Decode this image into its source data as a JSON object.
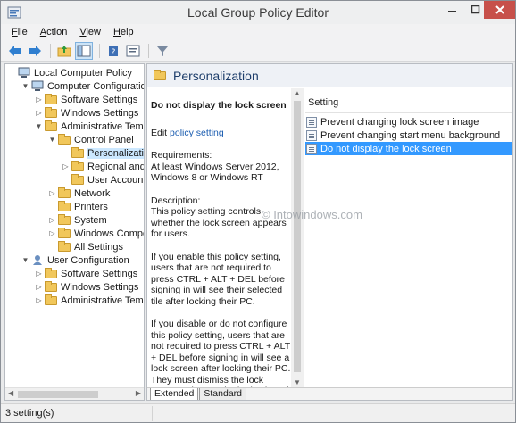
{
  "window": {
    "title": "Local Group Policy Editor"
  },
  "menubar": {
    "items": [
      {
        "pre": "",
        "key": "F",
        "post": "ile"
      },
      {
        "pre": "",
        "key": "A",
        "post": "ction"
      },
      {
        "pre": "",
        "key": "V",
        "post": "iew"
      },
      {
        "pre": "",
        "key": "H",
        "post": "elp"
      }
    ]
  },
  "toolbar": {
    "buttons": [
      "back-arrow-icon",
      "forward-arrow-icon",
      "up-folder-icon",
      "show-hide-tree-icon",
      "help-book-icon",
      "properties-icon",
      "filter-icon"
    ]
  },
  "tree": {
    "items": [
      {
        "label": "Local Computer Policy",
        "level": 0,
        "arrow": "",
        "icon": "computer"
      },
      {
        "label": "Computer Configuration",
        "level": 1,
        "arrow": "▼",
        "icon": "computer"
      },
      {
        "label": "Software Settings",
        "level": 2,
        "arrow": "▷",
        "icon": "folder"
      },
      {
        "label": "Windows Settings",
        "level": 2,
        "arrow": "▷",
        "icon": "folder"
      },
      {
        "label": "Administrative Templa",
        "level": 2,
        "arrow": "▼",
        "icon": "folder"
      },
      {
        "label": "Control Panel",
        "level": 3,
        "arrow": "▼",
        "icon": "folder"
      },
      {
        "label": "Personalization",
        "level": 4,
        "arrow": "",
        "icon": "folder",
        "selected": true
      },
      {
        "label": "Regional and L",
        "level": 4,
        "arrow": "▷",
        "icon": "folder"
      },
      {
        "label": "User Accounts",
        "level": 4,
        "arrow": "",
        "icon": "folder"
      },
      {
        "label": "Network",
        "level": 3,
        "arrow": "▷",
        "icon": "folder"
      },
      {
        "label": "Printers",
        "level": 3,
        "arrow": "",
        "icon": "folder"
      },
      {
        "label": "System",
        "level": 3,
        "arrow": "▷",
        "icon": "folder"
      },
      {
        "label": "Windows Compon",
        "level": 3,
        "arrow": "▷",
        "icon": "folder"
      },
      {
        "label": "All Settings",
        "level": 3,
        "arrow": "",
        "icon": "folder"
      },
      {
        "label": "User Configuration",
        "level": 1,
        "arrow": "▼",
        "icon": "user"
      },
      {
        "label": "Software Settings",
        "level": 2,
        "arrow": "▷",
        "icon": "folder"
      },
      {
        "label": "Windows Settings",
        "level": 2,
        "arrow": "▷",
        "icon": "folder"
      },
      {
        "label": "Administrative Templa",
        "level": 2,
        "arrow": "▷",
        "icon": "folder"
      }
    ]
  },
  "right": {
    "header": "Personalization",
    "description": {
      "heading": "Do not display the lock screen",
      "edit_prefix": "Edit ",
      "edit_link": "policy setting",
      "requirements_label": "Requirements:",
      "requirements": "At least Windows Server 2012, Windows 8 or Windows RT",
      "description_label": "Description:",
      "description": "This policy setting controls whether the lock screen appears for users.",
      "p1": "If you enable this policy setting, users that are not required to press CTRL + ALT + DEL before signing in will see their selected tile after locking their PC.",
      "p2": "If you disable or do not configure this policy setting, users that are not required to press CTRL + ALT + DEL before signing in will see a lock screen after locking their PC. They must dismiss the lock screen using touch, the keyboard, or by"
    },
    "list": {
      "column": "Setting",
      "rows": [
        {
          "label": "Prevent changing lock screen image"
        },
        {
          "label": "Prevent changing start menu background"
        },
        {
          "label": "Do not display the lock screen",
          "selected": true
        }
      ]
    },
    "watermark": "© Intowindows.com",
    "tabs": [
      "Extended",
      "Standard"
    ]
  },
  "status": {
    "text": "3 setting(s)"
  },
  "colors": {
    "selection": "#3399ff",
    "tree_selection": "#cce8ff",
    "close_button": "#c7504a",
    "header_text": "#1e3e6b"
  }
}
